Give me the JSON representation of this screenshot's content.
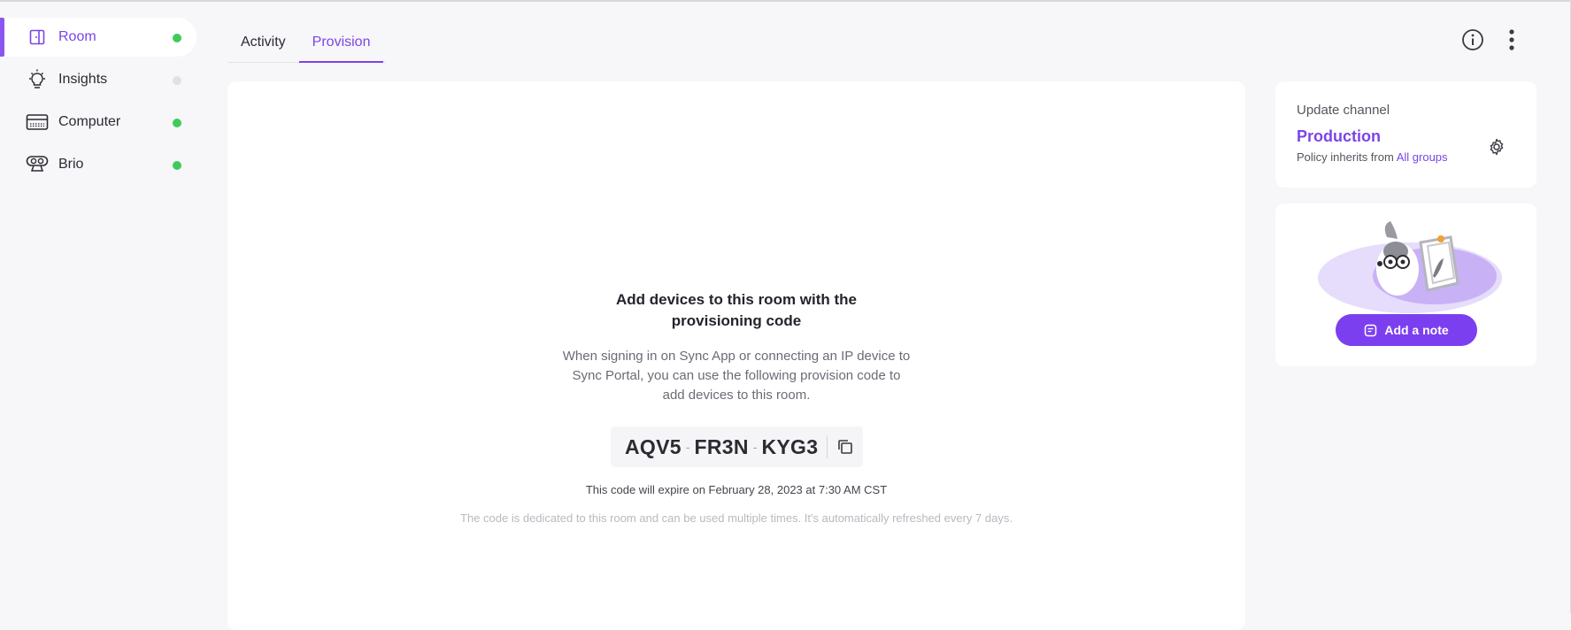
{
  "sidebar": {
    "items": [
      {
        "label": "Room",
        "icon": "room-icon",
        "status": "online",
        "active": true
      },
      {
        "label": "Insights",
        "icon": "lightbulb-icon",
        "status": "offline",
        "active": false
      },
      {
        "label": "Computer",
        "icon": "computer-icon",
        "status": "online",
        "active": false
      },
      {
        "label": "Brio",
        "icon": "webcam-icon",
        "status": "online",
        "active": false
      }
    ]
  },
  "tabs": [
    {
      "label": "Activity",
      "active": false
    },
    {
      "label": "Provision",
      "active": true
    }
  ],
  "header_actions": {
    "info_icon": "info-icon",
    "more_icon": "more-vertical-icon"
  },
  "provision": {
    "title_line1": "Add devices to this room with the",
    "title_line2": "provisioning code",
    "desc_line1": "When signing in on Sync App or connecting an IP device to",
    "desc_line2": "Sync Portal, you can use the following provision code to",
    "desc_line3": "add devices to this room.",
    "code": [
      "AQV5",
      "FR3N",
      "KYG3"
    ],
    "code_separator": "-",
    "expire_text": "This code will expire on February 28, 2023 at 7:30 AM CST",
    "refresh_text": "The code is dedicated to this room and can be used multiple times. It's automatically refreshed every 7 days."
  },
  "update_channel": {
    "label": "Update channel",
    "value": "Production",
    "policy_prefix": "Policy inherits from",
    "policy_link": "All groups"
  },
  "note": {
    "button_label": "Add a note"
  },
  "colors": {
    "accent": "#7a45e6",
    "online": "#3fcb5a",
    "offline": "#e1e1e4",
    "button": "#7b3ff0"
  }
}
